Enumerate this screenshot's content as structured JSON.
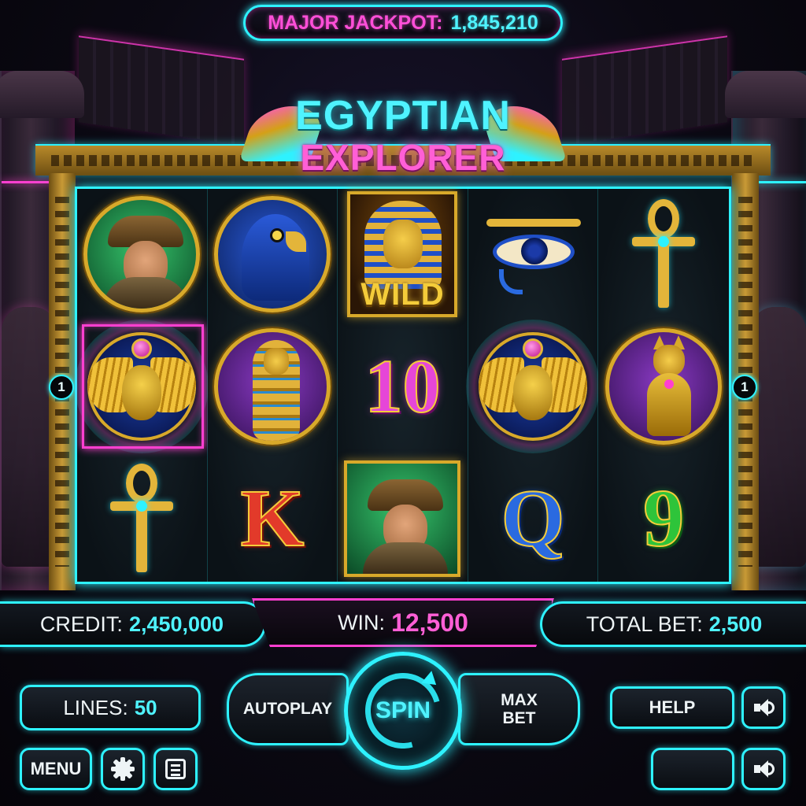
{
  "jackpot": {
    "label": "MAJOR JACKPOT:",
    "value": "1,845,210"
  },
  "title": {
    "line1": "EGYPTIAN",
    "line2": "EXPLORER"
  },
  "reels": [
    [
      "explorer",
      "scarab",
      "ankh"
    ],
    [
      "horus-falcon",
      "pharaoh-sarcophagus",
      "K"
    ],
    [
      "pharaoh-wild",
      "10",
      "explorer"
    ],
    [
      "eye-of-horus",
      "scarab",
      "Q"
    ],
    [
      "ankh",
      "bastet-cat",
      "9"
    ]
  ],
  "symbols": {
    "wild_label": "WILD",
    "ten": "10",
    "k": "K",
    "q": "Q",
    "nine": "9"
  },
  "paylines": {
    "left_marker": "1",
    "right_marker": "1"
  },
  "info": {
    "credit_label": "CREDIT:",
    "credit_value": "2,450,000",
    "win_label": "WIN:",
    "win_value": "12,500",
    "bet_label": "TOTAL BET:",
    "bet_value": "2,500"
  },
  "controls": {
    "lines_label": "LINES:",
    "lines_value": "50",
    "autoplay": "AUTOPLAY",
    "spin": "SPIN",
    "maxbet_1": "MAX",
    "maxbet_2": "BET",
    "help": "HELP",
    "menu": "MENU"
  },
  "colors": {
    "neon_cyan": "#2ef2ff",
    "neon_pink": "#ff3fd0",
    "gold": "#d8a92a"
  },
  "icons": [
    "speaker-icon",
    "gear-icon",
    "paytable-icon",
    "spin-arrow-icon"
  ]
}
